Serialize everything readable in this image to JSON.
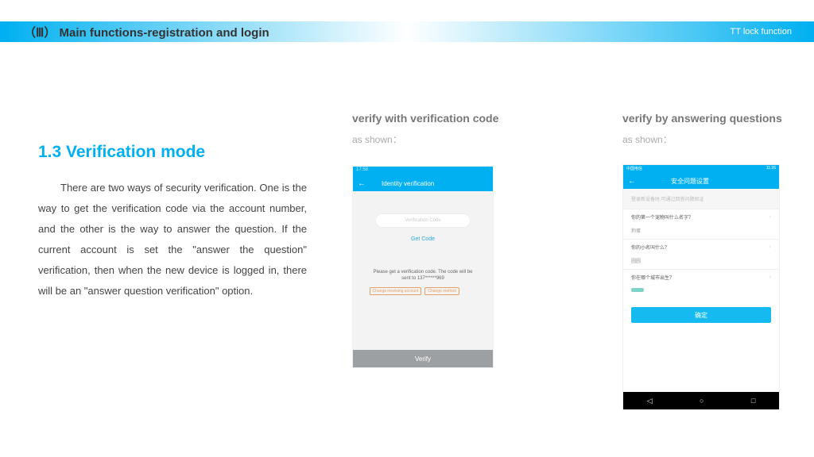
{
  "topbar": {
    "title": "（Ⅲ） Main functions-registration and login",
    "right": "TT lock function"
  },
  "section": {
    "heading": "1.3 Verification mode",
    "body": "There are two ways of security verification. One is the way to get the verification code via the account number, and the other is the way to answer the question. If the current account is set the \"answer the question\" verification, then when the new device is logged in, there will be an \"answer question verification\" option."
  },
  "col1": {
    "heading": "verify with verification code",
    "sub": "as shown："
  },
  "col2": {
    "heading": "verify by answering questions",
    "sub": "as shown："
  },
  "phone1": {
    "status_left": "17:58",
    "header": "Identity verification",
    "input_placeholder": "Verification Code",
    "get_code": "Get Code",
    "message": "Please get a verification code. The code will be sent to 137******969",
    "chip1": "Change receiving account",
    "chip2": "Change method",
    "verify_btn": "Verify"
  },
  "phone2": {
    "status_left": "中国电信",
    "status_right": "11:26",
    "header": "安全问题设置",
    "note": "登录新设备时,可通过回答问题验证",
    "q1": "你的第一个宠物叫什么名字？",
    "a1": "狗蛋",
    "q2": "你的小名叫什么？",
    "a2": "圆圆",
    "q3": "你在哪个城市出生？",
    "confirm": "确定"
  }
}
